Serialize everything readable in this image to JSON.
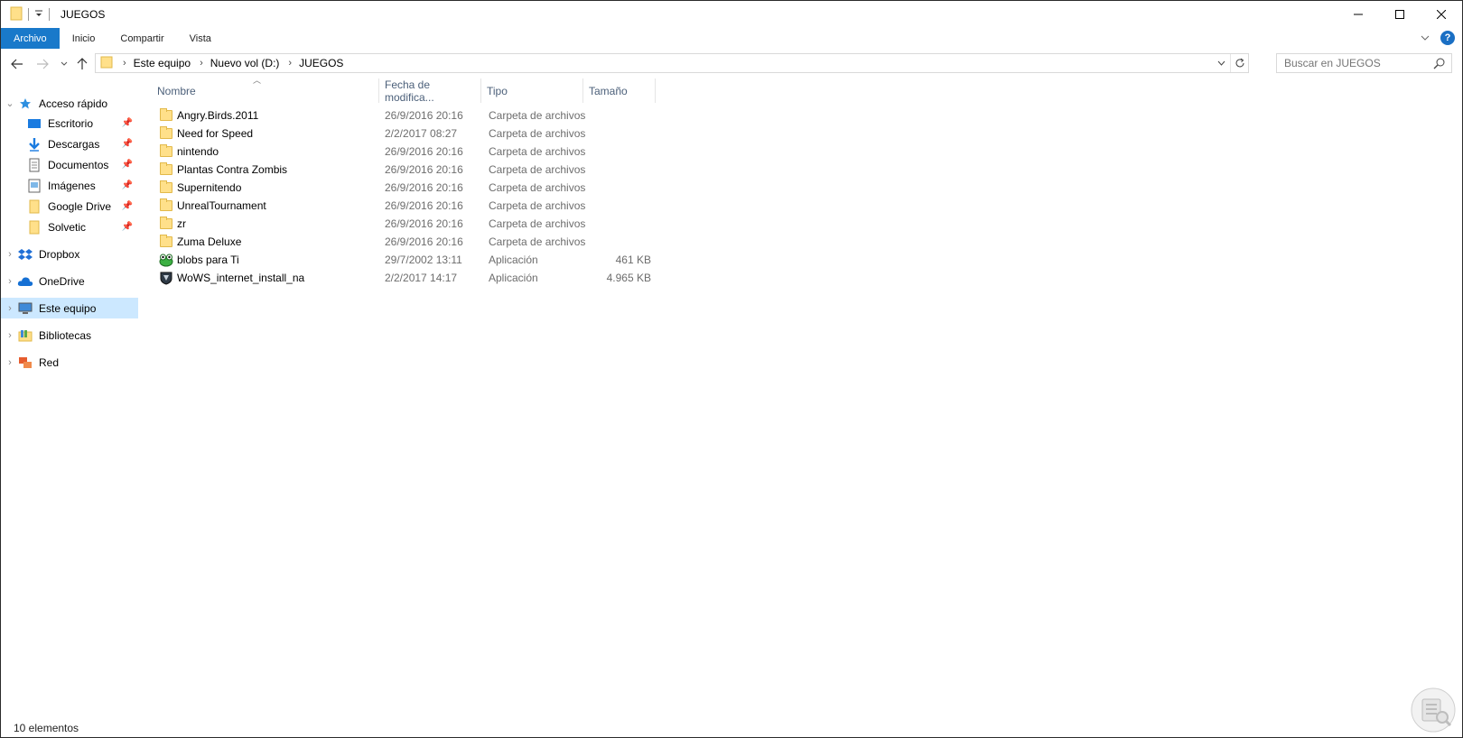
{
  "window": {
    "title": "JUEGOS"
  },
  "ribbon": {
    "tabs": [
      {
        "label": "Archivo",
        "active": true
      },
      {
        "label": "Inicio",
        "active": false
      },
      {
        "label": "Compartir",
        "active": false
      },
      {
        "label": "Vista",
        "active": false
      }
    ]
  },
  "address": {
    "crumbs": [
      "Este equipo",
      "Nuevo vol (D:)",
      "JUEGOS"
    ]
  },
  "search": {
    "placeholder": "Buscar en JUEGOS"
  },
  "nav_pane": {
    "quick_access": "Acceso rápido",
    "pinned": [
      {
        "label": "Escritorio",
        "icon": "desktop-icon"
      },
      {
        "label": "Descargas",
        "icon": "download-icon"
      },
      {
        "label": "Documentos",
        "icon": "document-icon"
      },
      {
        "label": "Imágenes",
        "icon": "pictures-icon"
      },
      {
        "label": "Google Drive",
        "icon": "folder-icon"
      },
      {
        "label": "Solvetic",
        "icon": "folder-icon"
      }
    ],
    "roots": [
      {
        "label": "Dropbox",
        "icon": "dropbox-icon",
        "selected": false
      },
      {
        "label": "OneDrive",
        "icon": "onedrive-icon",
        "selected": false
      },
      {
        "label": "Este equipo",
        "icon": "computer-icon",
        "selected": true
      },
      {
        "label": "Bibliotecas",
        "icon": "libraries-icon",
        "selected": false
      },
      {
        "label": "Red",
        "icon": "network-icon",
        "selected": false
      }
    ]
  },
  "columns": {
    "name": "Nombre",
    "date": "Fecha de modifica...",
    "type": "Tipo",
    "size": "Tamaño"
  },
  "files": [
    {
      "name": "Angry.Birds.2011",
      "date": "26/9/2016 20:16",
      "type": "Carpeta de archivos",
      "size": "",
      "icon": "folder-icon"
    },
    {
      "name": "Need for Speed",
      "date": "2/2/2017 08:27",
      "type": "Carpeta de archivos",
      "size": "",
      "icon": "folder-icon"
    },
    {
      "name": "nintendo",
      "date": "26/9/2016 20:16",
      "type": "Carpeta de archivos",
      "size": "",
      "icon": "folder-icon"
    },
    {
      "name": "Plantas Contra Zombis",
      "date": "26/9/2016 20:16",
      "type": "Carpeta de archivos",
      "size": "",
      "icon": "folder-icon"
    },
    {
      "name": "Supernitendo",
      "date": "26/9/2016 20:16",
      "type": "Carpeta de archivos",
      "size": "",
      "icon": "folder-icon"
    },
    {
      "name": "UnrealTournament",
      "date": "26/9/2016 20:16",
      "type": "Carpeta de archivos",
      "size": "",
      "icon": "folder-icon"
    },
    {
      "name": "zr",
      "date": "26/9/2016 20:16",
      "type": "Carpeta de archivos",
      "size": "",
      "icon": "folder-icon"
    },
    {
      "name": "Zuma Deluxe",
      "date": "26/9/2016 20:16",
      "type": "Carpeta de archivos",
      "size": "",
      "icon": "folder-icon"
    },
    {
      "name": "blobs para Ti",
      "date": "29/7/2002 13:11",
      "type": "Aplicación",
      "size": "461 KB",
      "icon": "frog-app-icon"
    },
    {
      "name": "WoWS_internet_install_na",
      "date": "2/2/2017 14:17",
      "type": "Aplicación",
      "size": "4.965 KB",
      "icon": "shield-app-icon"
    }
  ],
  "status": {
    "count": "10 elementos"
  },
  "colors": {
    "accent": "#1979ca",
    "selection": "#cce8ff",
    "header_text": "#4c607a"
  }
}
